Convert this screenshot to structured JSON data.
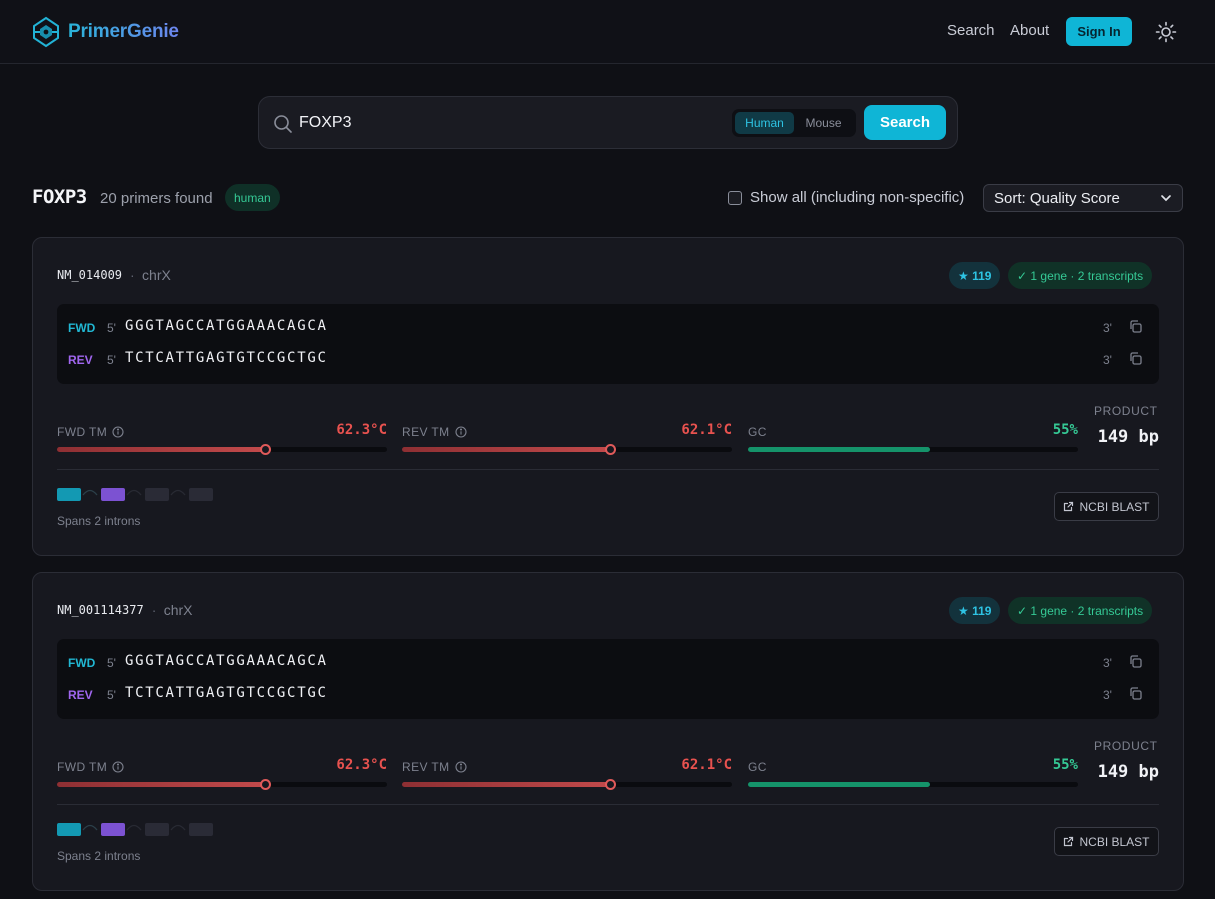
{
  "header": {
    "brand": "PrimerGenie",
    "nav": [
      {
        "label": "Search"
      },
      {
        "label": "About"
      }
    ],
    "signin_label": "Sign In"
  },
  "search": {
    "query": "FOXP3",
    "species_options": [
      "Human",
      "Mouse"
    ],
    "selected_species": "Human",
    "button_label": "Search"
  },
  "results": {
    "gene": "FOXP3",
    "count_text": "20 primers found",
    "species_badge": "human",
    "show_all_label": "Show all (including non-specific)",
    "show_all_checked": false,
    "sort_label": "Sort: Quality Score"
  },
  "cards": [
    {
      "accession": "NM_014009",
      "separator": "·",
      "chromosome": "chrX",
      "score": "★ 119",
      "specificity": "✓ 1 gene · 2 transcripts",
      "fwd": {
        "dir": "FWD",
        "five": "5'",
        "seq": "GGGTAGCCATGGAAACAGCA",
        "three": "3'"
      },
      "rev": {
        "dir": "REV",
        "five": "5'",
        "seq": "TCTCATTGAGTGTCCGCTGC",
        "three": "3'"
      },
      "fwd_tm": {
        "label": "FWD TM",
        "value": "62.3°C",
        "level_pct": 63
      },
      "rev_tm": {
        "label": "REV TM",
        "value": "62.1°C",
        "level_pct": 63
      },
      "gc": {
        "label": "GC",
        "value": "55%",
        "level_pct": 55
      },
      "product_label": "PRODUCT",
      "product_value": "149 bp",
      "spans_text": "Spans 2 introns",
      "blast_label": "NCBI BLAST"
    },
    {
      "accession": "NM_001114377",
      "separator": "·",
      "chromosome": "chrX",
      "score": "★ 119",
      "specificity": "✓ 1 gene · 2 transcripts",
      "fwd": {
        "dir": "FWD",
        "five": "5'",
        "seq": "GGGTAGCCATGGAAACAGCA",
        "three": "3'"
      },
      "rev": {
        "dir": "REV",
        "five": "5'",
        "seq": "TCTCATTGAGTGTCCGCTGC",
        "three": "3'"
      },
      "fwd_tm": {
        "label": "FWD TM",
        "value": "62.3°C",
        "level_pct": 63
      },
      "rev_tm": {
        "label": "REV TM",
        "value": "62.1°C",
        "level_pct": 63
      },
      "gc": {
        "label": "GC",
        "value": "55%",
        "level_pct": 55
      },
      "product_label": "PRODUCT",
      "product_value": "149 bp",
      "spans_text": "Spans 2 introns",
      "blast_label": "NCBI BLAST"
    }
  ],
  "colors": {
    "accent": "#0fb5d6",
    "fwd": "#21b7d3",
    "rev": "#a066ef",
    "tm": "#e05a5a",
    "gc": "#35c995"
  }
}
